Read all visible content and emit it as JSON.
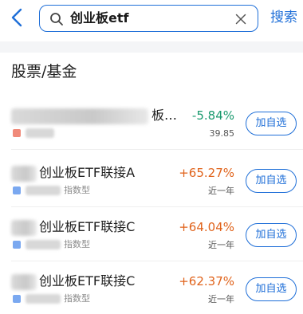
{
  "search": {
    "query": "创业板etf",
    "button": "搜索"
  },
  "section": {
    "title": "股票/基金"
  },
  "colors": {
    "accent": "#1f6fd8",
    "up": "#e0621a",
    "down": "#1a9a6e",
    "stock_tag": "#f08a7a",
    "fund_tag": "#7aa8f0"
  },
  "icons": {
    "back": "chevron-left-icon",
    "search": "search-icon",
    "clear": "close-icon"
  },
  "results": [
    {
      "name": "板…",
      "type_label": "",
      "change": "-5.84%",
      "sub": "39.85",
      "direction": "down",
      "tag": "stock",
      "add_label": "加自选"
    },
    {
      "name": "创业板ETF联接A",
      "type_label": "指数型",
      "change": "+65.27%",
      "sub": "近一年",
      "direction": "up",
      "tag": "fund",
      "add_label": "加自选"
    },
    {
      "name": "创业板ETF联接C",
      "type_label": "指数型",
      "change": "+64.04%",
      "sub": "近一年",
      "direction": "up",
      "tag": "fund",
      "add_label": "加自选"
    },
    {
      "name": "创业板ETF联接C",
      "type_label": "指数型",
      "change": "+62.37%",
      "sub": "近一年",
      "direction": "up",
      "tag": "fund",
      "add_label": "加自选"
    }
  ]
}
